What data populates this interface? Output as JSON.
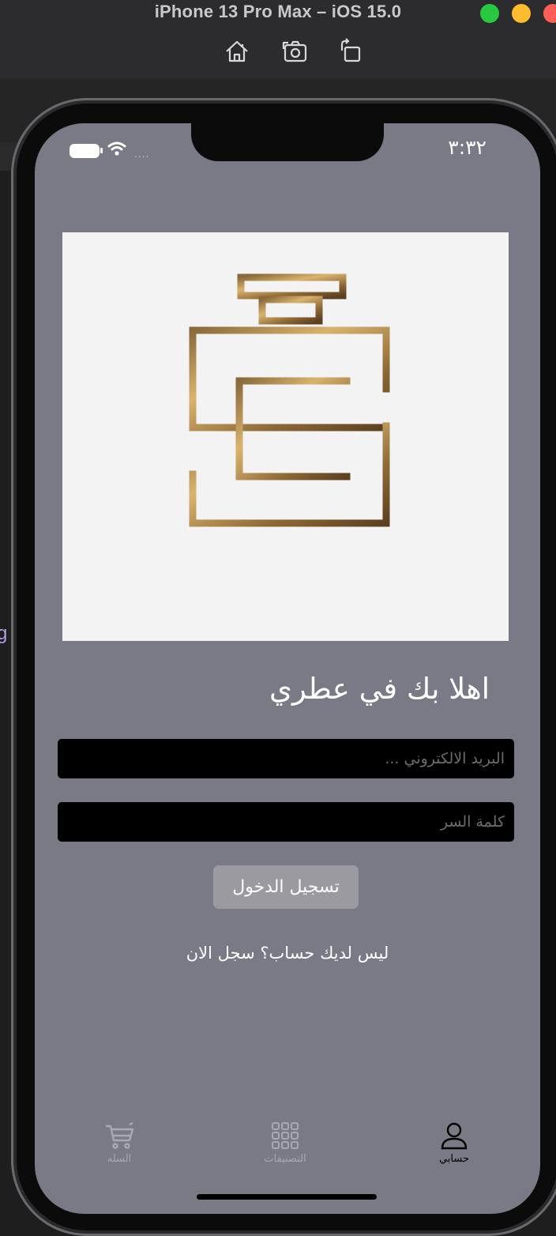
{
  "simulator": {
    "title": "iPhone 13 Pro Max – iOS 15.0",
    "toolbar_icons": [
      "home-icon",
      "screenshot-icon",
      "rotate-icon"
    ],
    "traffic_lights": {
      "close": "#ff5f57",
      "minimize": "#febc2e",
      "zoom": "#28c840"
    }
  },
  "background": {
    "side_text": "g"
  },
  "status_bar": {
    "time": "٣:٣٢",
    "carrier": "....",
    "icons": [
      "battery-icon",
      "wifi-icon"
    ]
  },
  "logo": {
    "icon": "perfume-bottle-logo",
    "color": "#b9894a"
  },
  "welcome": {
    "title": "اهلا بك في عطري"
  },
  "form": {
    "email_placeholder": "البريد الالكتروني ...",
    "email_value": "",
    "password_placeholder": "كلمة السر",
    "password_value": "",
    "login_label": "تسجيل الدخول",
    "register_text": "ليس لديك حساب؟ سجل الان"
  },
  "tabs": [
    {
      "label": "السله",
      "icon": "cart-icon",
      "active": false
    },
    {
      "label": "التصنيفات",
      "icon": "grid-icon",
      "active": false
    },
    {
      "label": "حسابي",
      "icon": "person-icon",
      "active": true
    }
  ],
  "colors": {
    "screen_bg": "#7a7a86",
    "input_bg": "#000000",
    "button_bg": "#9a9aa0",
    "tab_active": "#000000",
    "tab_inactive": "#a9a9b4"
  }
}
